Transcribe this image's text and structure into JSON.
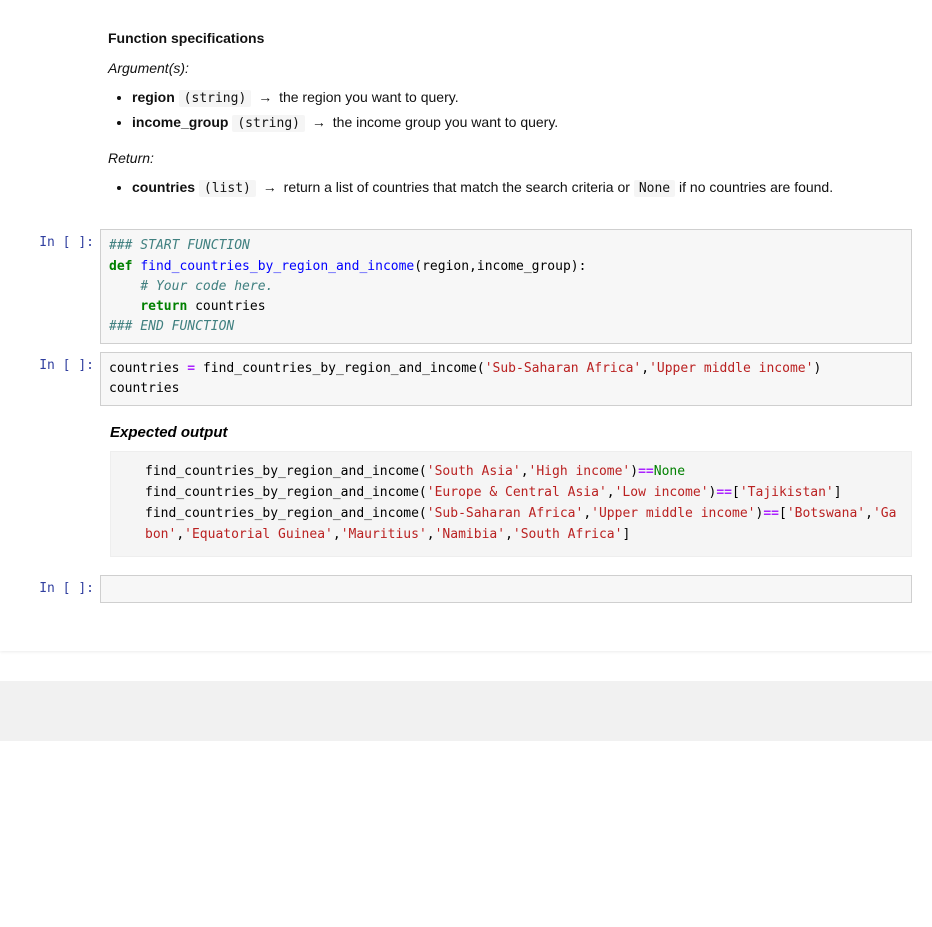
{
  "spec": {
    "title": "Function specifications",
    "args_head": "Argument(s):",
    "args": [
      {
        "name": "region",
        "type": "(string)",
        "desc": "the region you want to query."
      },
      {
        "name": "income_group",
        "type": "(string)",
        "desc": "the income group you want to query."
      }
    ],
    "return_head": "Return:",
    "return": {
      "name": "countries",
      "type": "(list)",
      "desc_1": "return a list of countries that match the search criteria or",
      "none_code": "None",
      "desc_2": "if no countries are found."
    }
  },
  "prompts": {
    "in": "In [ ]:"
  },
  "code1": {
    "c1": "### START FUNCTION",
    "kw_def": "def",
    "fn": "find_countries_by_region_and_income",
    "sig": "(region,income_group):",
    "c2": "# Your code here.",
    "kw_ret": "return",
    "ret_id": " countries",
    "c3": "### END FUNCTION"
  },
  "code2": {
    "l1a": "countries ",
    "op_eq": "=",
    "l1b": " find_countries_by_region_and_income(",
    "s1": "'Sub-Saharan Africa'",
    "l1c": ",",
    "s2": "'Upper middle income'",
    "l1d": ")",
    "l2": "countries"
  },
  "expected": {
    "title": "Expected output",
    "l1a": "find_countries_by_region_and_income(",
    "l1s1": "'South Asia'",
    "l1b": ",",
    "l1s2": "'High income'",
    "l1c": ")",
    "l1op": "==",
    "l1none": "None",
    "l2a": "find_countries_by_region_and_income(",
    "l2s1": "'Europe & Central Asia'",
    "l2b": ",",
    "l2s2": "'Low income'",
    "l2c": ")",
    "l2op": "==",
    "l2d": "[",
    "l2s3": "'Tajikistan'",
    "l2e": "]",
    "l3a": "find_countries_by_region_and_income(",
    "l3s1": "'Sub-Saharan Africa'",
    "l3b": ",",
    "l3s2": "'Upper middle income'",
    "l3c": ")",
    "l3op": "==",
    "l3d": "[",
    "l3s3": "'Botswana'",
    "l3e": ",",
    "l3s4": "'Gabon'",
    "l3f": ",",
    "l3s5": "'Equatorial Guinea'",
    "l3g": ",",
    "l3s6": "'Mauritius'",
    "l3h": ",",
    "l3s7": "'Namibia'",
    "l3i": ",",
    "l3s8": "'South Africa'",
    "l3j": "]"
  }
}
